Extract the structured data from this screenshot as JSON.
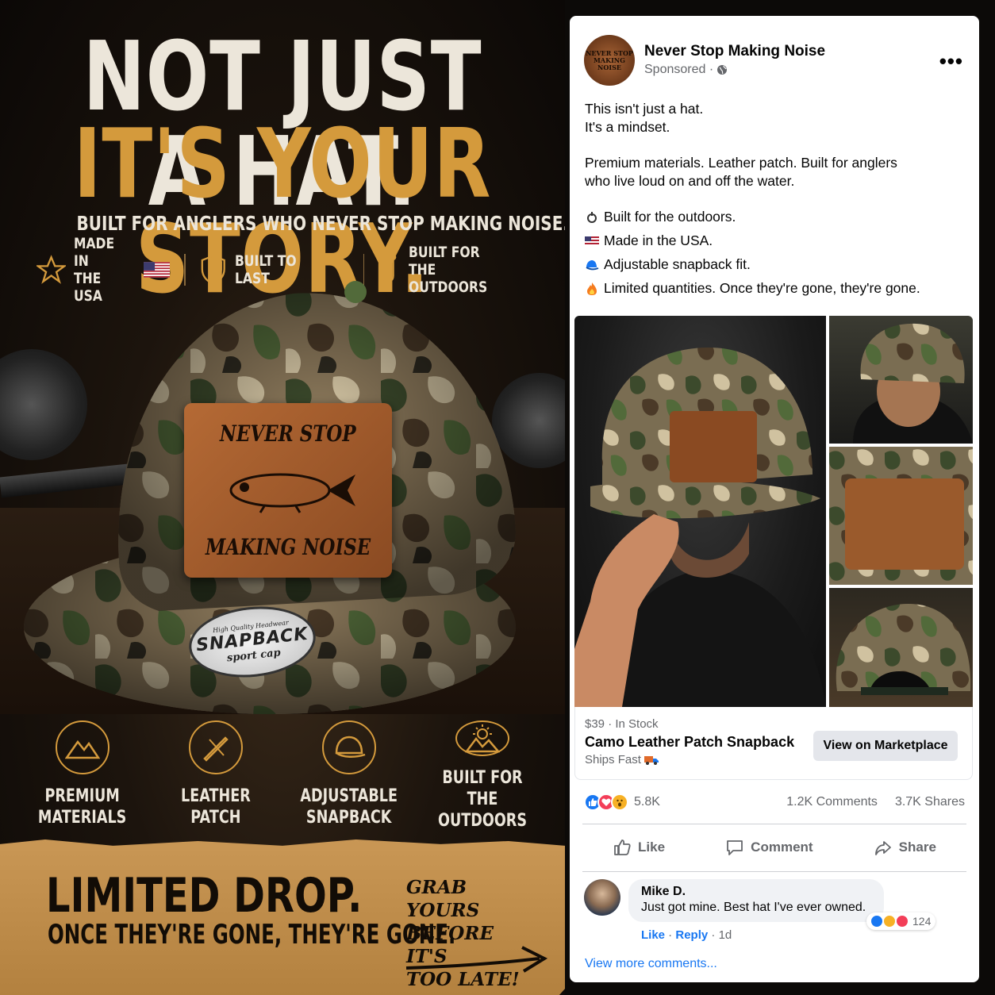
{
  "poster": {
    "headline_line1": "NOT JUST A HAT.",
    "headline_line2": "IT'S YOUR STORY.",
    "tagline": "BUILT FOR ANGLERS WHO NEVER STOP MAKING NOISE.",
    "top_features": [
      {
        "label_line1": "MADE IN",
        "label_line2": "THE USA",
        "icon": "star-icon"
      },
      {
        "label_line1": "BUILT TO LAST",
        "label_line2": "",
        "icon": "shield-icon"
      },
      {
        "label_line1": "BUILT FOR THE",
        "label_line2": "OUTDOORS",
        "icon": "fishing-hook-icon"
      }
    ],
    "patch_top": "NEVER STOP",
    "patch_bottom": "MAKING NOISE",
    "badge_top": "High Quality Headwear",
    "badge_main": "SNAPBACK",
    "badge_sub": "sport cap",
    "bottom_features": [
      {
        "line1": "PREMIUM",
        "line2": "MATERIALS",
        "icon": "mountains-icon"
      },
      {
        "line1": "LEATHER",
        "line2": "PATCH",
        "icon": "needle-icon"
      },
      {
        "line1": "ADJUSTABLE",
        "line2": "SNAPBACK",
        "icon": "cap-icon"
      },
      {
        "line1": "BUILT FOR THE",
        "line2": "OUTDOORS",
        "icon": "sun-mountain-icon"
      }
    ],
    "banner_title": "LIMITED DROP.",
    "banner_sub": "ONCE THEY'RE GONE, THEY'RE GONE.",
    "banner_cta_line1": "GRAB YOURS",
    "banner_cta_line2": "BEFORE IT'S",
    "banner_cta_line3": "TOO LATE!",
    "colors": {
      "accent": "#d49a3c",
      "cream": "#ece6da",
      "banner": "#c99755"
    }
  },
  "post": {
    "page_name": "Never Stop Making Noise",
    "sponsored": "Sponsored ·",
    "more": "•••",
    "avatar_text": "NEVER STOP MAKING NOISE",
    "body": {
      "line1": "This isn't just a hat.",
      "line2": "It's a mindset.",
      "line3": "Premium materials. Leather patch. Built for anglers",
      "line4": "who live loud on and off the water.",
      "bullets": [
        {
          "icon": "fishing-reel-icon",
          "text": "Built for the outdoors."
        },
        {
          "icon": "us-flag-icon",
          "text": "Made in the USA."
        },
        {
          "icon": "blue-cap-icon",
          "text": "Adjustable snapback fit."
        },
        {
          "icon": "fire-icon",
          "text": "Limited quantities. Once they're gone, they're gone."
        }
      ]
    },
    "product": {
      "price": "$39 · In Stock",
      "title": "Camo Leather Patch Snapback",
      "shipping": "Ships Fast",
      "button": "View on Marketplace"
    },
    "stats": {
      "reactions": "5.8K",
      "comments": "1.2K Comments",
      "shares": "3.7K Shares"
    },
    "actions": {
      "like": "Like",
      "comment": "Comment",
      "share": "Share"
    },
    "comment": {
      "name": "Mike D.",
      "text": "Just got mine. Best hat I've ever owned.",
      "like": "Like",
      "reply": "Reply",
      "time": "1d",
      "reaction_count": "124"
    },
    "view_more": "View more comments...",
    "colors": {
      "link": "#1877f2",
      "muted": "#65676b",
      "like_blue": "#1877f2",
      "love_red": "#f33e58",
      "wow_yellow": "#f7b125"
    }
  }
}
